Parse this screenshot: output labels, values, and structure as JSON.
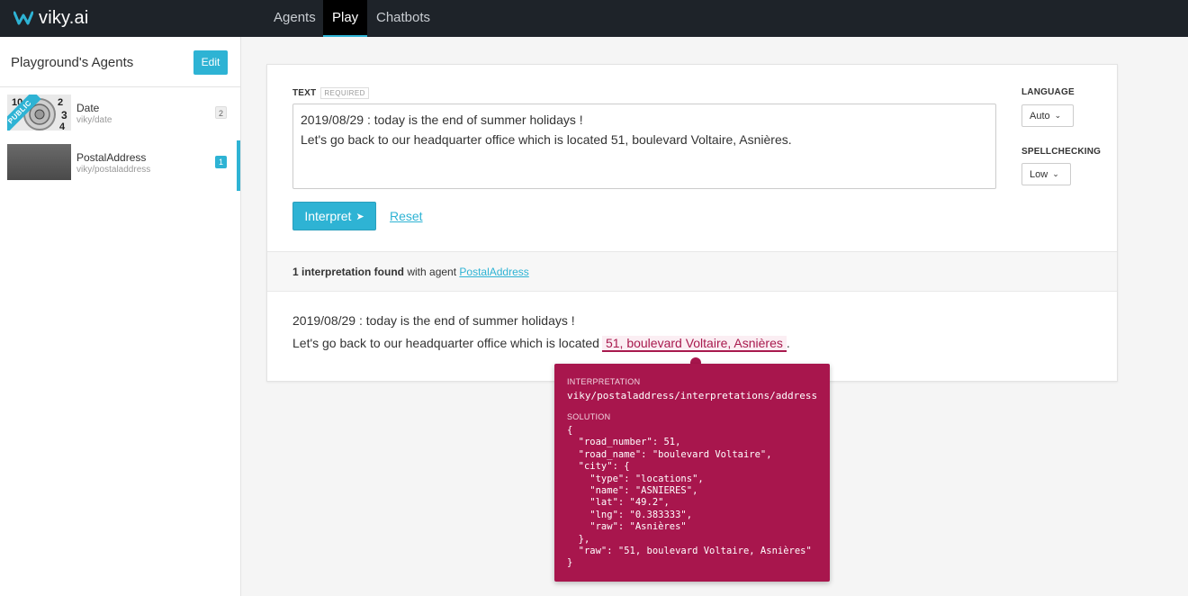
{
  "brand": {
    "name": "viky.ai",
    "accent": "#2eb3d4"
  },
  "nav": {
    "agents": "Agents",
    "play": "Play",
    "chatbots": "Chatbots"
  },
  "sidebar": {
    "title": "Playground's Agents",
    "edit_label": "Edit",
    "agents": [
      {
        "name": "Date",
        "slug": "viky/date",
        "count": "2",
        "badge": "PUBLIC"
      },
      {
        "name": "PostalAddress",
        "slug": "viky/postaladdress",
        "count": "1"
      }
    ]
  },
  "form": {
    "text_label": "TEXT",
    "required_label": "REQUIRED",
    "text_value": "2019/08/29 : today is the end of summer holidays !\nLet's go back to our headquarter office which is located 51, boulevard Voltaire, Asnières.",
    "interpret_label": "Interpret",
    "reset_label": "Reset",
    "language_label": "LANGUAGE",
    "language_value": "Auto",
    "spellchecking_label": "SPELLCHECKING",
    "spellchecking_value": "Low"
  },
  "result": {
    "count_text": "1 interpretation found",
    "with_agent_text": "with agent",
    "agent_link": "PostalAddress",
    "line1": "2019/08/29 : today is the end of summer holidays !",
    "line2_before": "Let's go back to our headquarter office which is located",
    "line2_highlight": "51, boulevard Voltaire, Asnières",
    "line2_after": "."
  },
  "tooltip": {
    "interpretation_label": "INTERPRETATION",
    "interpretation_value": "viky/postaladdress/interpretations/address",
    "solution_label": "SOLUTION",
    "solution_code": "{\n  \"road_number\": 51,\n  \"road_name\": \"boulevard Voltaire\",\n  \"city\": {\n    \"type\": \"locations\",\n    \"name\": \"ASNIERES\",\n    \"lat\": \"49.2\",\n    \"lng\": \"0.383333\",\n    \"raw\": \"Asnières\"\n  },\n  \"raw\": \"51, boulevard Voltaire, Asnières\"\n}",
    "color": "#a8164d"
  }
}
